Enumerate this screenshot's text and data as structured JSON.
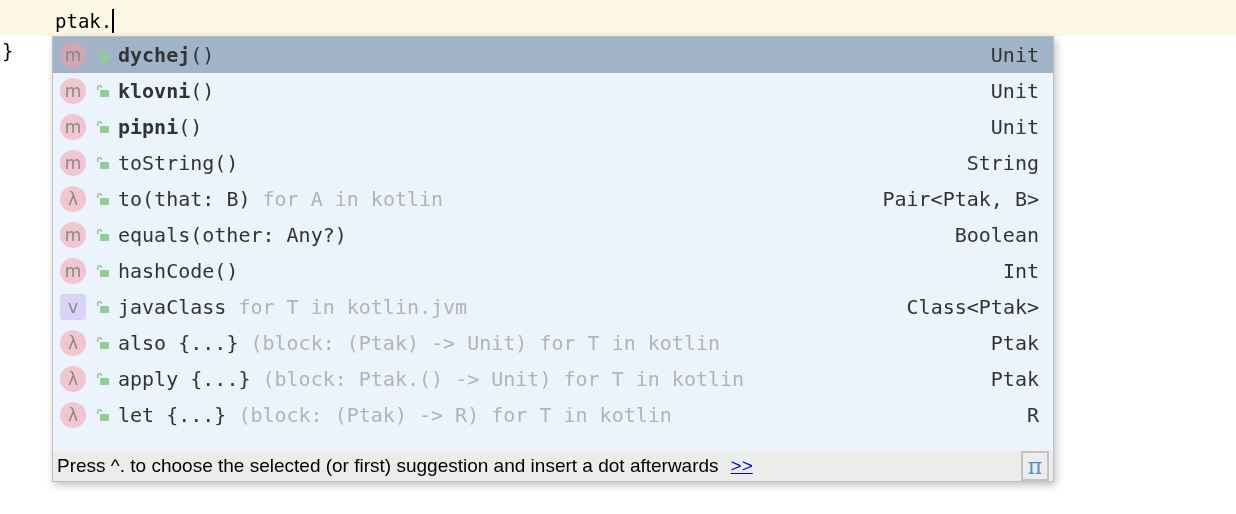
{
  "editor": {
    "current_line": "ptak.",
    "next_line": "}"
  },
  "completion": {
    "items": [
      {
        "kind": "method",
        "badge": "m",
        "name": "dychej",
        "args": "()",
        "type": "Unit",
        "bold": true,
        "selected": true
      },
      {
        "kind": "method",
        "badge": "m",
        "name": "klovni",
        "args": "()",
        "type": "Unit",
        "bold": true,
        "selected": false
      },
      {
        "kind": "method",
        "badge": "m",
        "name": "pipni",
        "args": "()",
        "type": "Unit",
        "bold": true,
        "selected": false
      },
      {
        "kind": "method",
        "badge": "m",
        "name": "toString",
        "args": "()",
        "type": "String",
        "bold": false,
        "selected": false
      },
      {
        "kind": "function",
        "badge": "λ",
        "name": "to",
        "args": "(that: B)",
        "hint": "for A in kotlin",
        "type": "Pair<Ptak, B>",
        "bold": false,
        "selected": false
      },
      {
        "kind": "method",
        "badge": "m",
        "name": "equals",
        "args": "(other: Any?)",
        "type": "Boolean",
        "bold": false,
        "selected": false
      },
      {
        "kind": "method",
        "badge": "m",
        "name": "hashCode",
        "args": "()",
        "type": "Int",
        "bold": false,
        "selected": false
      },
      {
        "kind": "property",
        "badge": "v",
        "name": "javaClass",
        "hint": "for T in kotlin.jvm",
        "type": "Class<Ptak>",
        "bold": false,
        "selected": false
      },
      {
        "kind": "function",
        "badge": "λ",
        "name": "also",
        "args": " {...}",
        "hint": "(block: (Ptak) -> Unit) for T in kotlin",
        "type": "Ptak",
        "bold": false,
        "selected": false
      },
      {
        "kind": "function",
        "badge": "λ",
        "name": "apply",
        "args": " {...}",
        "hint": "(block: Ptak.() -> Unit) for T in kotlin",
        "type": "Ptak",
        "bold": false,
        "selected": false
      },
      {
        "kind": "function",
        "badge": "λ",
        "name": "let",
        "args": " {...}",
        "hint": "(block: (Ptak) -> R) for T in kotlin",
        "type": "R",
        "bold": false,
        "selected": false
      }
    ],
    "footer": {
      "text": "Press ^. to choose the selected (or first) suggestion and insert a dot afterwards",
      "link": ">>",
      "pi": "π"
    }
  }
}
